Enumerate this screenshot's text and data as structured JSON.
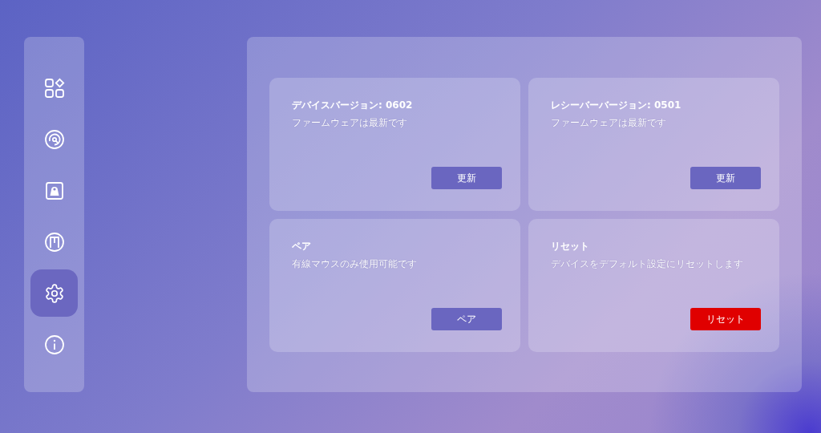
{
  "sidebar": {
    "items": [
      {
        "kind": "apps",
        "selected": false
      },
      {
        "kind": "dial",
        "selected": false
      },
      {
        "kind": "profile",
        "selected": false
      },
      {
        "kind": "macro",
        "selected": false
      },
      {
        "kind": "settings",
        "selected": true
      },
      {
        "kind": "info",
        "selected": false
      }
    ]
  },
  "cards": [
    {
      "title": "デバイスバージョン: 0602",
      "description": "ファームウェアは最新です",
      "button": {
        "label": "更新",
        "kind": "primary"
      }
    },
    {
      "title": "レシーバーバージョン: 0501",
      "description": "ファームウェアは最新です",
      "button": {
        "label": "更新",
        "kind": "primary"
      }
    },
    {
      "title": "ペア",
      "description": "有線マウスのみ使用可能です",
      "button": {
        "label": "ペア",
        "kind": "primary"
      }
    },
    {
      "title": "リセット",
      "description": "デバイスをデフォルト設定にリセットします",
      "button": {
        "label": "リセット",
        "kind": "danger"
      }
    }
  ]
}
